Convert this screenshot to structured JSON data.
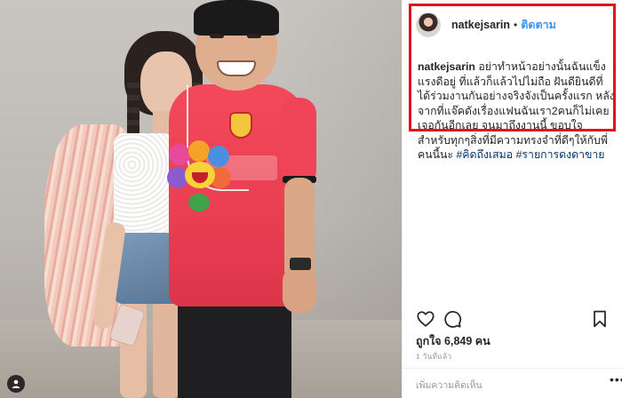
{
  "post": {
    "username": "natkejsarin",
    "separator": "•",
    "follow_label": "ติดตาม",
    "caption": {
      "user": "natkejsarin",
      "text": " อย่าทำหน้าอย่างนั้นฉันแข็งแรงดีอยู่ ที่แล้วก็แล้วไปไม่ถือ ฝันดียินดีที่ได้ร่วมงานกันอย่างจริงจังเป็นครั้งแรก หลังจากที่แจ๊คดังเรื่องแฟนฉันเรา2คนก็ไม่เคยเจอกันอีกเลย จนมาถึงงานนี้ ขอบใจสำหรับทุกๆสิ่งที่มีความทรงจำที่ดีๆให้กับพี่คนนี้นะ ",
      "hashtags": [
        "#คิดถึงเสมอ",
        "#รายการดงดาขาย"
      ]
    },
    "likes_text": "ถูกใจ 6,849 คน",
    "time_text": "1 วันที่แล้ว",
    "comment_placeholder": "เพิ่มความคิดเห็น",
    "more_glyph": "•••"
  },
  "icons": {
    "like": "heart-icon",
    "comment": "comment-icon",
    "save": "bookmark-icon",
    "user_tag": "user-tag-icon",
    "more": "more-options-icon"
  },
  "colors": {
    "highlight_border": "#e3121e",
    "follow_blue": "#3897f0",
    "hashtag": "#003569",
    "muted_text": "#999999"
  }
}
